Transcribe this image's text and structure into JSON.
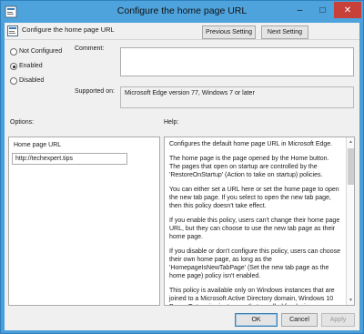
{
  "window": {
    "title": "Configure the home page URL"
  },
  "header": {
    "policy_name": "Configure the home page URL",
    "previous_setting": "Previous Setting",
    "next_setting": "Next Setting"
  },
  "state": {
    "options": [
      "Not Configured",
      "Enabled",
      "Disabled"
    ],
    "selected": "Enabled"
  },
  "comment": {
    "label": "Comment:",
    "value": ""
  },
  "supported": {
    "label": "Supported on:",
    "value": "Microsoft Edge version 77, Windows 7 or later"
  },
  "options_panel": {
    "label": "Options:",
    "field_label": "Home page URL",
    "field_value": "http://techexpert.tips"
  },
  "help_panel": {
    "label": "Help:",
    "paragraphs": [
      "Configures the default home page URL in Microsoft Edge.",
      "The home page is the page opened by the Home button. The pages that open on startup are controlled by the 'RestoreOnStartup' (Action to take on startup) policies.",
      "You can either set a URL here or set the home page to open the new tab page. If you select to open the new tab page, then this policy doesn't take effect.",
      "If you enable this policy, users can't change their home page URL, but they can choose to use the new tab page as their home page.",
      "If you disable or don't configure this policy, users can choose their own home page, as long as the 'HomepageIsNewTabPage' (Set the new tab page as the home page) policy isn't enabled.",
      "This policy is available only on Windows instances that are joined to a Microsoft Active Directory domain, Windows 10 Pro or Enterprise instances that enrolled for device management, or"
    ]
  },
  "footer": {
    "ok": "OK",
    "cancel": "Cancel",
    "apply": "Apply"
  },
  "colors": {
    "titlebar": "#4ea3dc",
    "close_button": "#c7403a",
    "dialog_background": "#f0f0f0"
  }
}
